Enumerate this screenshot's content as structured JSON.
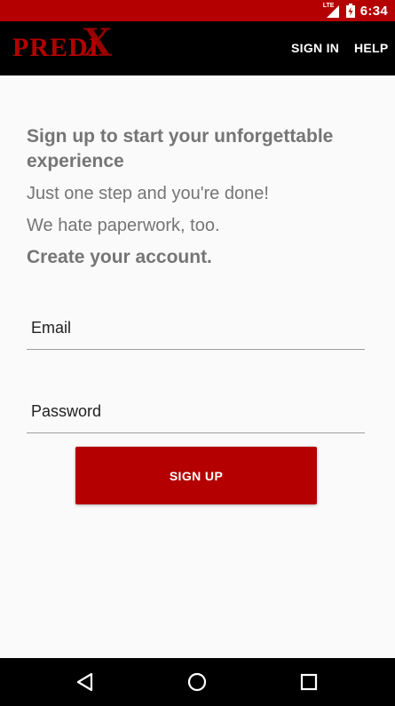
{
  "status_bar": {
    "time": "6:34",
    "network": "LTE",
    "bg_color": "#b40000"
  },
  "app_bar": {
    "logo_text": "PREDI",
    "logo_mark": "X",
    "sign_in_label": "SIGN IN",
    "help_label": "HELP"
  },
  "content": {
    "headline": "Sign up to start your unforgettable experience",
    "subline": "Just one step and you're done!",
    "subline2": "We hate paperwork, too.",
    "create_title": "Create your account."
  },
  "form": {
    "email_placeholder": "Email",
    "password_placeholder": "Password",
    "signup_label": "SIGN UP"
  },
  "nav_bar": {
    "back_icon": "triangle-back-icon",
    "home_icon": "circle-home-icon",
    "recents_icon": "square-recents-icon"
  },
  "colors": {
    "brand_red": "#b40000",
    "text_gray": "#757575"
  }
}
